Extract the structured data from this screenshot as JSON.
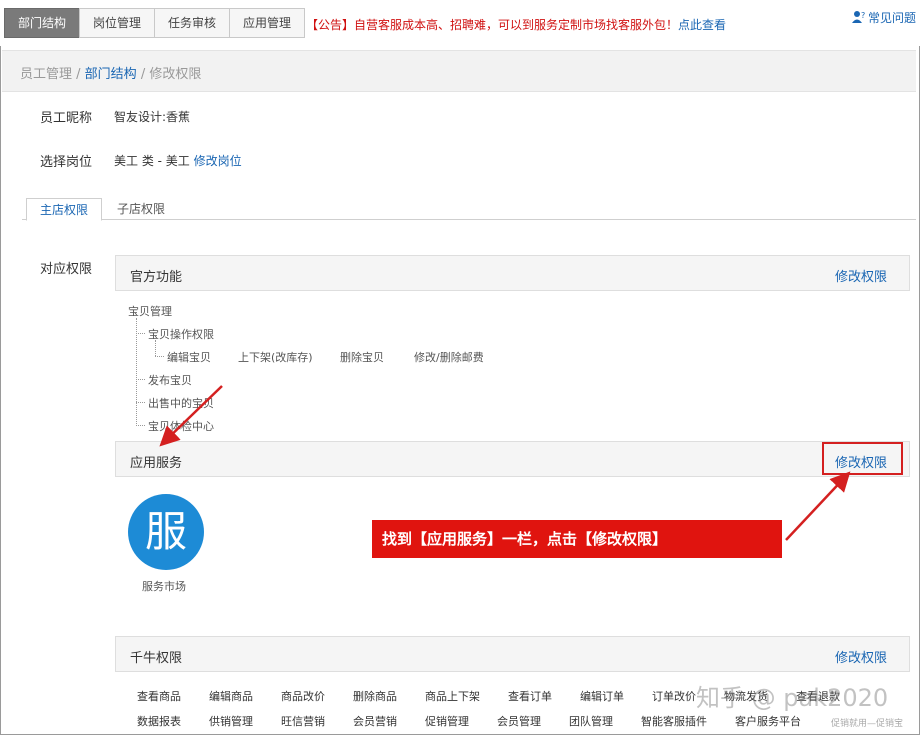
{
  "top_tabs": [
    "部门结构",
    "岗位管理",
    "任务审核",
    "应用管理"
  ],
  "notice": {
    "text": "【公告】自营客服成本高、招聘难，可以到服务定制市场找客服外包！",
    "link": "点此查看"
  },
  "faq": "常见问题",
  "breadcrumb": {
    "item1": "员工管理",
    "sep": " / ",
    "item2": "部门结构",
    "item3": "修改权限"
  },
  "employee": {
    "label": "员工昵称",
    "value": "智友设计:香蕉"
  },
  "position": {
    "label": "选择岗位",
    "value": "美工 类 - 美工",
    "link": "修改岗位"
  },
  "sub_tabs": {
    "main": "主店权限",
    "sub": "子店权限"
  },
  "perm_label": "对应权限",
  "official": {
    "title": "官方功能",
    "edit": "修改权限",
    "tree": {
      "root": "宝贝管理",
      "ops": "宝贝操作权限",
      "leaves": [
        "编辑宝贝",
        "上下架(改库存)",
        "删除宝贝",
        "修改/删除邮费"
      ],
      "items": [
        "发布宝贝",
        "出售中的宝贝",
        "宝贝体检中心"
      ]
    }
  },
  "app_service": {
    "title": "应用服务",
    "edit": "修改权限",
    "icon_char": "服",
    "icon_label": "服务市场"
  },
  "callout": "找到【应用服务】一栏，点击【修改权限】",
  "qianniu": {
    "title": "千牛权限",
    "edit": "修改权限",
    "row1": [
      "查看商品",
      "编辑商品",
      "商品改价",
      "删除商品",
      "商品上下架",
      "查看订单",
      "编辑订单",
      "订单改价",
      "物流发货",
      "查看退款"
    ],
    "row2": [
      "数据报表",
      "供销管理",
      "旺信营销",
      "会员营销",
      "促销管理",
      "会员管理",
      "团队管理",
      "智能客服插件",
      "客户服务平台"
    ]
  },
  "watermark": "知乎 @ pak2020",
  "watermark2": "促销就用—促销宝",
  "colors": {
    "accent_blue": "#1a66b3",
    "alert_red": "#e0140f",
    "icon_blue": "#1d8bd6"
  }
}
